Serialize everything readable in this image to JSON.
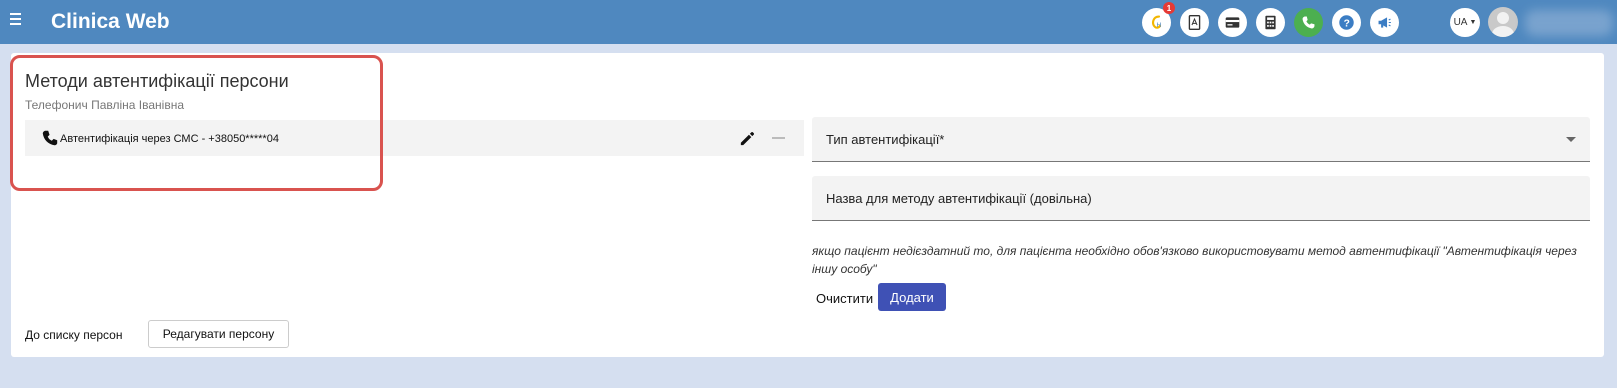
{
  "header": {
    "app_title": "Clinica Web",
    "notification_count": "1",
    "language": "UA",
    "icons": [
      "logo-h-icon",
      "pdf-icon",
      "card-icon",
      "calculator-icon",
      "phone-icon",
      "help-icon",
      "megaphone-icon"
    ]
  },
  "page": {
    "title": "Методи автентифікації персони",
    "person_name": "Телефонич Павліна Іванівна"
  },
  "methods": [
    {
      "icon": "phone-icon",
      "label": "Автентифікація через СМС - +38050*****04"
    }
  ],
  "form": {
    "type_label": "Тип автентифікації*",
    "name_label": "Назва для методу автентифікації (довільна)",
    "note": "якщо пацієнт недієздатний то, для пацієнта необхідно обов'язково використовувати метод автентифікації \"Автентифікація через іншу особу\"",
    "clear_label": "Очистити",
    "add_label": "Додати"
  },
  "footer": {
    "back_link": "До списку персон",
    "edit_person_label": "Редагувати персону"
  },
  "colors": {
    "topbar": "#4f88bf",
    "primary_button": "#3f51b5",
    "highlight_border": "#d9534f",
    "phone_green": "#4caf50"
  }
}
